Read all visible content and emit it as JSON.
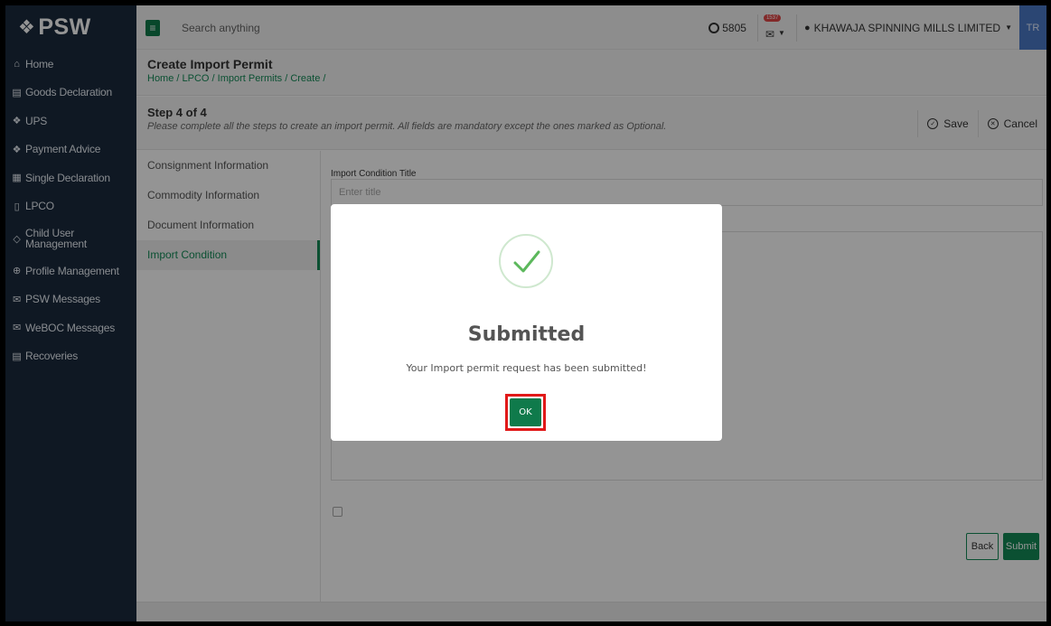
{
  "brand": {
    "name": "PSW"
  },
  "sidebar": {
    "items": [
      {
        "label": "Home",
        "icon": "home-icon"
      },
      {
        "label": "Goods Declaration",
        "icon": "document-icon"
      },
      {
        "label": "UPS",
        "icon": "diamond-icon"
      },
      {
        "label": "Payment Advice",
        "icon": "diamond-icon"
      },
      {
        "label": "Single Declaration",
        "icon": "table-icon"
      },
      {
        "label": "LPCO",
        "icon": "file-icon"
      },
      {
        "label": "Child User Management",
        "icon": "user-tag-icon"
      },
      {
        "label": "Profile Management",
        "icon": "profile-icon"
      },
      {
        "label": "PSW Messages",
        "icon": "messages-icon"
      },
      {
        "label": "WeBOC Messages",
        "icon": "envelope-icon"
      },
      {
        "label": "Recoveries",
        "icon": "receipt-icon"
      }
    ]
  },
  "topbar": {
    "search_placeholder": "Search anything",
    "coins": "5805",
    "notifications": "1537",
    "company": "KHAWAJA SPINNING MILLS LIMITED",
    "avatar": "TR"
  },
  "page": {
    "title": "Create Import Permit",
    "breadcrumb": "Home / LPCO / Import Permits / Create /",
    "step": "Step 4 of 4",
    "hint": "Please complete all the steps to create an import permit. All fields are mandatory except the ones marked as Optional.",
    "save": "Save",
    "cancel": "Cancel"
  },
  "tabs": [
    "Consignment Information",
    "Commodity Information",
    "Document Information",
    "Import Condition"
  ],
  "active_tab": "Import Condition",
  "form": {
    "title_label": "Import Condition Title",
    "title_placeholder": "Enter title",
    "back": "Back",
    "submit": "Submit"
  },
  "modal": {
    "title": "Submitted",
    "message": "Your Import permit request has been submitted!",
    "ok": "OK"
  },
  "colors": {
    "sidebar": "#1b2a3d",
    "accent": "#138b57",
    "highlight": "#e11919",
    "avatar": "#4b79c7"
  }
}
